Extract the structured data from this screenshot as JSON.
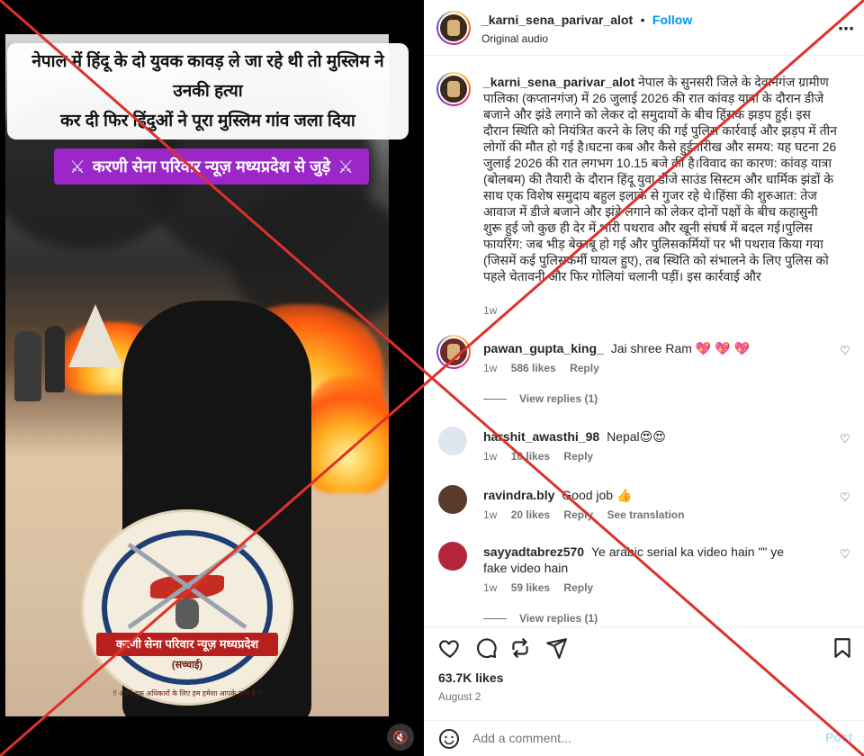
{
  "media": {
    "caption_line1": "नेपाल में हिंदू के दो युवक कावड़ ले जा रहे थी तो मुस्लिम ने उनकी हत्या",
    "caption_line2": "कर दी फिर हिंदुओं ने पूरा मुस्लिम गांव जला दिया",
    "banner_text": "करणी सेना परिवार न्यूज़ मध्यप्रदेश से जुड़े",
    "banner_icon": "crossed-swords-icon",
    "logo_ribbon": "करणी सेना परिवार न्यूज़ मध्यप्रदेश",
    "logo_sub": "(सच्चाई)",
    "logo_tagline": "!! अपने हक अधिकारों के लिए हम हमेशा आपके साथ है !!",
    "mute_icon": "speaker-muted-icon"
  },
  "header": {
    "username": "_karni_sena_parivar_alot",
    "separator": "•",
    "follow_label": "Follow",
    "audio": "Original audio",
    "more_icon": "more-options-icon"
  },
  "post_caption": {
    "username": "_karni_sena_parivar_alot",
    "text": "नेपाल के सुनसरी जिले के देवानगंज ग्रामीण पालिका (कप्तानगंज) में 26 जुलाई 2026 की रात कांवड़ यात्रा के दौरान डीजे बजाने और झंडे लगाने को लेकर दो समुदायों के बीच हिंसक झड़प हुई। इस दौरान स्थिति को नियंत्रित करने के लिए की गई पुलिस कार्रवाई और झड़प में तीन लोगों की मौत हो गई है।घटना कब और कैसे हुईतारीख और समय: यह घटना 26 जुलाई 2026 की रात लगभग 10.15 बजे की है।विवाद का कारण: कांवड़ यात्रा (बोलबम) की तैयारी के दौरान हिंदू युवा डीजे साउंड सिस्टम और धार्मिक झंडों के साथ एक विशेष समुदाय बहुल इलाके से गुजर रहे थे।हिंसा की शुरुआत: तेज आवाज में डीजे बजाने और झंडे लगाने को लेकर दोनों पक्षों के बीच कहासुनी शुरू हुई जो कुछ ही देर में भारी पथराव और खूनी संघर्ष में बदल गई।पुलिस फायरिंग: जब भीड़ बेकाबू हो गई और पुलिसकर्मियों पर भी पथराव किया गया (जिसमें कई पुलिसकर्मी घायल हुए), तब स्थिति को संभालने के लिए पुलिस को पहले चेतावनी और फिर गोलियां चलानी पड़ीं। इस कार्रवाई और",
    "time": "1w"
  },
  "comments": [
    {
      "username": "pawan_gupta_king_",
      "text": "Jai shree Ram 💖 💖 💖",
      "time": "1w",
      "likes": "586 likes",
      "reply": "Reply",
      "view_replies": "View replies (1)"
    },
    {
      "username": "harshit_awasthi_98",
      "text": "Nepal😍😍",
      "time": "1w",
      "likes": "10 likes",
      "reply": "Reply"
    },
    {
      "username": "ravindra.bly",
      "text": "Good job 👍",
      "time": "1w",
      "likes": "20 likes",
      "reply": "Reply",
      "translation": "See translation"
    },
    {
      "username": "sayyadtabrez570",
      "text": "Ye arabic serial ka video hain \"\" ye fake video hain",
      "time": "1w",
      "likes": "59 likes",
      "reply": "Reply",
      "view_replies": "View replies (1)"
    }
  ],
  "actions": {
    "like_icon": "heart-icon",
    "comment_icon": "comment-icon",
    "share_icon": "repost-icon",
    "send_icon": "send-icon",
    "save_icon": "bookmark-icon",
    "likes": "63.7K likes",
    "date": "August 2"
  },
  "add_comment": {
    "placeholder": "Add a comment...",
    "post_label": "Post",
    "emoji_icon": "emoji-icon"
  },
  "colors": {
    "overlay_cross": "#e0302a",
    "follow": "#0095f6",
    "banner": "#9b27c9"
  }
}
